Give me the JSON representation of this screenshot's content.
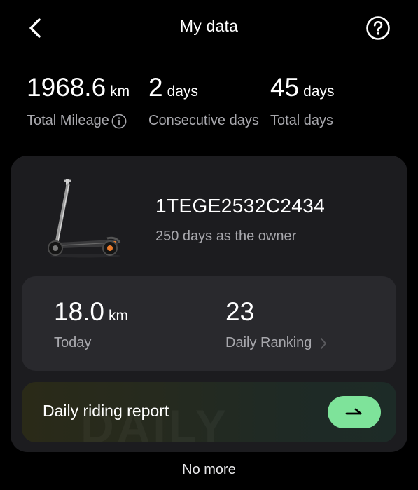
{
  "header": {
    "title": "My data",
    "back_icon": "chevron-left-icon",
    "help_icon": "question-circle-icon"
  },
  "stats": {
    "total_mileage": {
      "value": "1968.6",
      "unit": "km",
      "label": "Total Mileage"
    },
    "consecutive_days": {
      "value": "2",
      "unit": "days",
      "label": "Consecutive days"
    },
    "total_days": {
      "value": "45",
      "unit": "days",
      "label": "Total days"
    }
  },
  "device": {
    "id": "1TEGE2532C2434",
    "owner_text": "250 days as the owner"
  },
  "today": {
    "value": "18.0",
    "unit": "km",
    "label": "Today"
  },
  "ranking": {
    "value": "23",
    "label": "Daily Ranking"
  },
  "report": {
    "label": "Daily riding report",
    "watermark": "DAILY"
  },
  "footer": {
    "no_more": "No more"
  },
  "colors": {
    "background": "#000000",
    "card": "#1c1c1f",
    "inner_card": "#29292d",
    "secondary_text": "#a8a8ad",
    "accent_green": "#7ee39a"
  }
}
